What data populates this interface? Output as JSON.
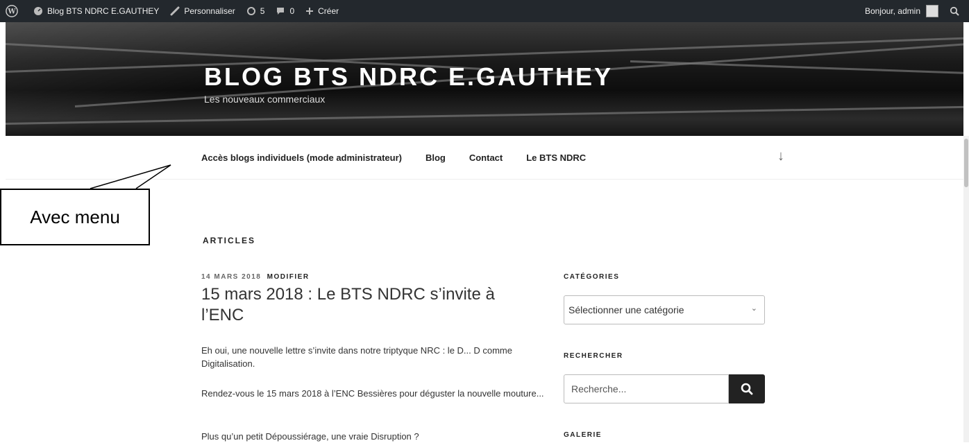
{
  "adminbar": {
    "site_name": "Blog BTS NDRC E.GAUTHEY",
    "customize": "Personnaliser",
    "updates": "5",
    "comments": "0",
    "new": "Créer",
    "greeting": "Bonjour, admin"
  },
  "header": {
    "site_title": "BLOG BTS NDRC E.GAUTHEY",
    "tagline": "Les nouveaux commerciaux"
  },
  "nav": {
    "items": [
      "Accès blogs individuels (mode administrateur)",
      "Blog",
      "Contact",
      "Le BTS NDRC"
    ],
    "scroll_arrow": "↓"
  },
  "annotation": {
    "text": "Avec menu"
  },
  "main": {
    "section_title": "ARTICLES",
    "post": {
      "date": "14 MARS 2018",
      "edit": "MODIFIER",
      "title": "15 mars 2018 : Le BTS NDRC s’invite à l’ENC",
      "paragraphs": [
        "Eh oui, une nouvelle lettre s’invite dans notre triptyque NRC : le D... D comme Digitalisation.",
        "Rendez-vous le 15 mars 2018 à l’ENC Bessières pour déguster la nouvelle mouture...",
        "Plus qu’un petit Dépoussiérage, une vraie Disruption ?"
      ]
    }
  },
  "sidebar": {
    "categories_title": "CATÉGORIES",
    "categories_select": "Sélectionner une catégorie",
    "search_title": "RECHERCHER",
    "search_placeholder": "Recherche...",
    "gallery_title": "GALERIE"
  },
  "colors": {
    "adminbar_bg": "#23282d",
    "button_dark": "#222222"
  }
}
